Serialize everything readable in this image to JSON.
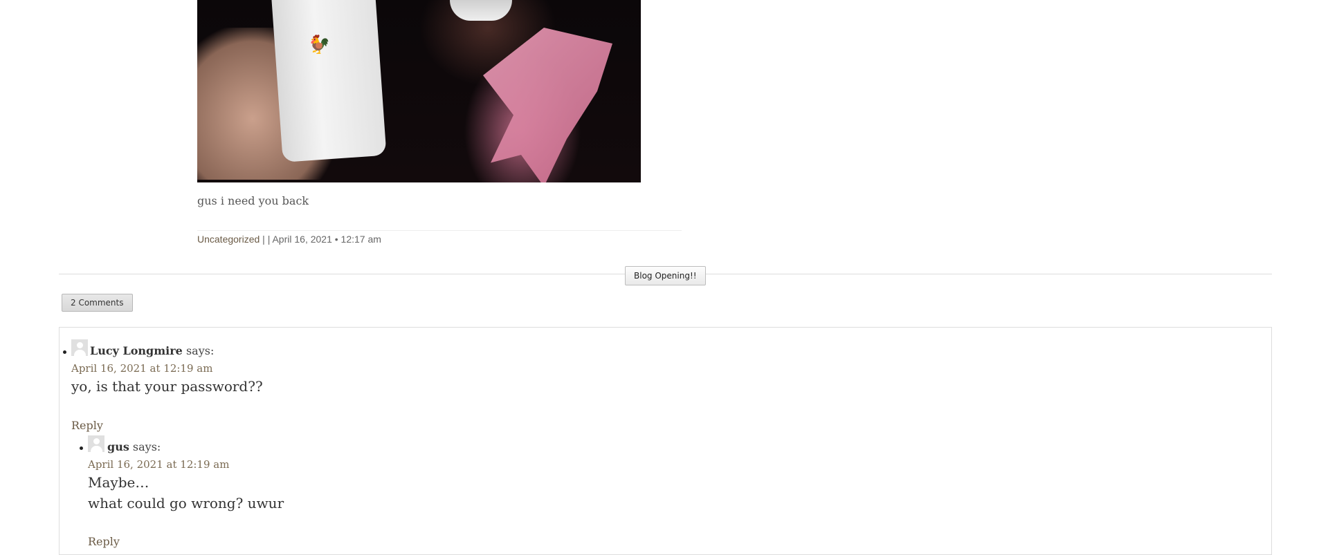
{
  "post": {
    "caption": "gus i need you back",
    "meta": {
      "category": "Uncategorized",
      "separator": "| |",
      "datetime": "April 16, 2021 • 12:17 am"
    }
  },
  "nav": {
    "next_post_label": "Blog Opening!!"
  },
  "comments": {
    "tab_label": "2 Comments",
    "items": [
      {
        "author": "Lucy Longmire",
        "says": "says:",
        "date": "April 16, 2021 at 12:19 am",
        "lines": [
          "yo, is that your password??"
        ],
        "reply_label": "Reply"
      },
      {
        "author": "gus",
        "says": "says:",
        "date": "April 16, 2021 at 12:19 am",
        "lines": [
          "Maybe…",
          "what could go wrong? uwur"
        ],
        "reply_label": "Reply"
      }
    ]
  }
}
